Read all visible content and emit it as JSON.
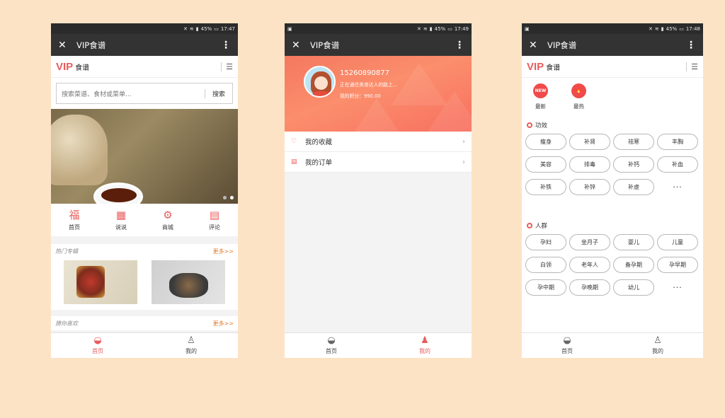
{
  "status": {
    "p1": {
      "battery": "45%",
      "time": "17:47"
    },
    "p2": {
      "battery": "45%",
      "time": "17:49"
    },
    "p3": {
      "battery": "45%",
      "time": "17:48"
    }
  },
  "app_title": "VIP食谱",
  "logo": {
    "vip": "VIP",
    "text": "食谱"
  },
  "search": {
    "placeholder": "搜索菜谱、食材或菜单...",
    "button": "搜索"
  },
  "home": {
    "icons": [
      {
        "label": "首页",
        "glyph": "福"
      },
      {
        "label": "说说",
        "glyph": "▦"
      },
      {
        "label": "商城",
        "glyph": "⚙"
      },
      {
        "label": "评论",
        "glyph": "▤"
      }
    ],
    "hot": {
      "title": "热门专辑",
      "more": "更多>>"
    },
    "guess": {
      "title": "猜你喜欢",
      "more": "更多>>"
    }
  },
  "tabbar": {
    "home": "首页",
    "mine": "我的"
  },
  "profile": {
    "phone": "15260890877",
    "status": "正在通往美食达人的路上...",
    "points": "我的积分：990.00",
    "menu": [
      {
        "label": "我的收藏",
        "icon": "heart-icon"
      },
      {
        "label": "我的订单",
        "icon": "list-icon"
      }
    ]
  },
  "category": {
    "top": [
      {
        "label": "最新",
        "badge": "NEW"
      },
      {
        "label": "最热",
        "badge": "🔥"
      }
    ],
    "groups": [
      {
        "title": "功效",
        "tags": [
          "瘦身",
          "补肾",
          "祛寒",
          "丰胸",
          "美容",
          "排毒",
          "补钙",
          "补血",
          "补铁",
          "补锌",
          "补虚",
          "···"
        ]
      },
      {
        "title": "人群",
        "tags": [
          "孕妇",
          "坐月子",
          "婴儿",
          "儿童",
          "白领",
          "老年人",
          "备孕期",
          "孕早期",
          "孕中期",
          "孕晚期",
          "幼儿",
          "···"
        ]
      }
    ]
  }
}
